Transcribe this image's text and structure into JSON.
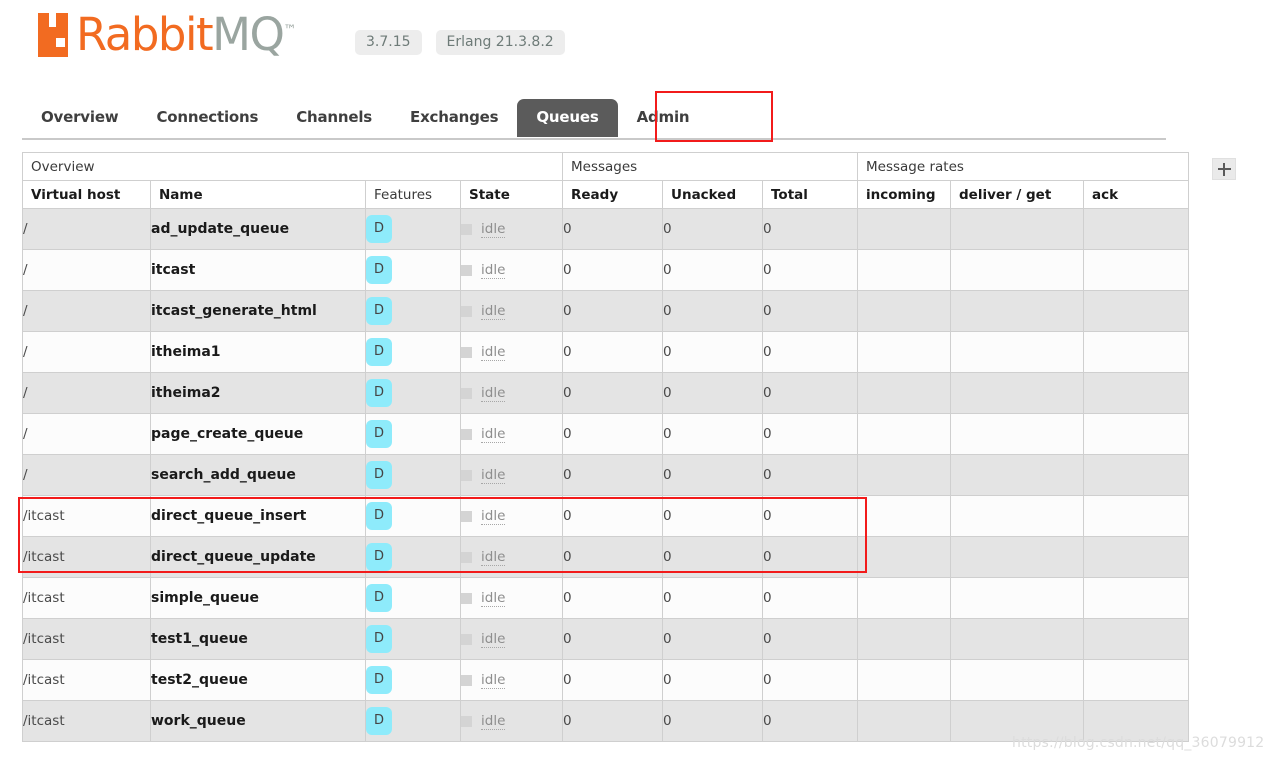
{
  "header": {
    "logo_text_primary": "Rabbit",
    "logo_text_secondary": "MQ",
    "logo_tm": "™",
    "logo_icon": "rabbit-logo-icon",
    "version_badge": "3.7.15",
    "erlang_badge": "Erlang 21.3.8.2"
  },
  "tabs": [
    {
      "label": "Overview",
      "active": false
    },
    {
      "label": "Connections",
      "active": false
    },
    {
      "label": "Channels",
      "active": false
    },
    {
      "label": "Exchanges",
      "active": false
    },
    {
      "label": "Queues",
      "active": true
    },
    {
      "label": "Admin",
      "active": false
    }
  ],
  "table": {
    "group_headers": [
      {
        "label": "Overview",
        "span": 4
      },
      {
        "label": "Messages",
        "span": 3
      },
      {
        "label": "Message rates",
        "span": 3
      }
    ],
    "columns": [
      {
        "label": "Virtual host",
        "bold": true,
        "align": "left"
      },
      {
        "label": "Name",
        "bold": true,
        "align": "left"
      },
      {
        "label": "Features",
        "bold": false,
        "align": "left"
      },
      {
        "label": "State",
        "bold": true,
        "align": "left"
      },
      {
        "label": "Ready",
        "bold": true,
        "align": "left"
      },
      {
        "label": "Unacked",
        "bold": true,
        "align": "left"
      },
      {
        "label": "Total",
        "bold": true,
        "align": "left"
      },
      {
        "label": "incoming",
        "bold": true,
        "align": "left"
      },
      {
        "label": "deliver / get",
        "bold": true,
        "align": "left"
      },
      {
        "label": "ack",
        "bold": true,
        "align": "left"
      }
    ],
    "add_column_button": "+",
    "rows": [
      {
        "vhost": "/",
        "name": "ad_update_queue",
        "features": "D",
        "state": "idle",
        "ready": "0",
        "unacked": "0",
        "total": "0",
        "incoming": "",
        "deliver_get": "",
        "ack": ""
      },
      {
        "vhost": "/",
        "name": "itcast",
        "features": "D",
        "state": "idle",
        "ready": "0",
        "unacked": "0",
        "total": "0",
        "incoming": "",
        "deliver_get": "",
        "ack": ""
      },
      {
        "vhost": "/",
        "name": "itcast_generate_html",
        "features": "D",
        "state": "idle",
        "ready": "0",
        "unacked": "0",
        "total": "0",
        "incoming": "",
        "deliver_get": "",
        "ack": ""
      },
      {
        "vhost": "/",
        "name": "itheima1",
        "features": "D",
        "state": "idle",
        "ready": "0",
        "unacked": "0",
        "total": "0",
        "incoming": "",
        "deliver_get": "",
        "ack": ""
      },
      {
        "vhost": "/",
        "name": "itheima2",
        "features": "D",
        "state": "idle",
        "ready": "0",
        "unacked": "0",
        "total": "0",
        "incoming": "",
        "deliver_get": "",
        "ack": ""
      },
      {
        "vhost": "/",
        "name": "page_create_queue",
        "features": "D",
        "state": "idle",
        "ready": "0",
        "unacked": "0",
        "total": "0",
        "incoming": "",
        "deliver_get": "",
        "ack": ""
      },
      {
        "vhost": "/",
        "name": "search_add_queue",
        "features": "D",
        "state": "idle",
        "ready": "0",
        "unacked": "0",
        "total": "0",
        "incoming": "",
        "deliver_get": "",
        "ack": ""
      },
      {
        "vhost": "/itcast",
        "name": "direct_queue_insert",
        "features": "D",
        "state": "idle",
        "ready": "0",
        "unacked": "0",
        "total": "0",
        "incoming": "",
        "deliver_get": "",
        "ack": ""
      },
      {
        "vhost": "/itcast",
        "name": "direct_queue_update",
        "features": "D",
        "state": "idle",
        "ready": "0",
        "unacked": "0",
        "total": "0",
        "incoming": "",
        "deliver_get": "",
        "ack": ""
      },
      {
        "vhost": "/itcast",
        "name": "simple_queue",
        "features": "D",
        "state": "idle",
        "ready": "0",
        "unacked": "0",
        "total": "0",
        "incoming": "",
        "deliver_get": "",
        "ack": ""
      },
      {
        "vhost": "/itcast",
        "name": "test1_queue",
        "features": "D",
        "state": "idle",
        "ready": "0",
        "unacked": "0",
        "total": "0",
        "incoming": "",
        "deliver_get": "",
        "ack": ""
      },
      {
        "vhost": "/itcast",
        "name": "test2_queue",
        "features": "D",
        "state": "idle",
        "ready": "0",
        "unacked": "0",
        "total": "0",
        "incoming": "",
        "deliver_get": "",
        "ack": ""
      },
      {
        "vhost": "/itcast",
        "name": "work_queue",
        "features": "D",
        "state": "idle",
        "ready": "0",
        "unacked": "0",
        "total": "0",
        "incoming": "",
        "deliver_get": "",
        "ack": ""
      }
    ]
  },
  "annotations": {
    "tab_highlight_color": "#F21B1B",
    "row_highlight_color": "#F21B1B",
    "highlighted_rows": [
      "direct_queue_insert",
      "direct_queue_update"
    ]
  },
  "watermark": "https://blog.csdn.net/qq_36079912",
  "colors": {
    "brand_orange": "#F26B21",
    "logo_gray": "#9AA5A0",
    "active_tab_bg": "#5B5B5B",
    "feature_badge_bg": "#8EEBFB",
    "row_odd_bg": "#E4E4E4",
    "row_even_bg": "#FCFCFC",
    "border": "#CFCFCF"
  }
}
